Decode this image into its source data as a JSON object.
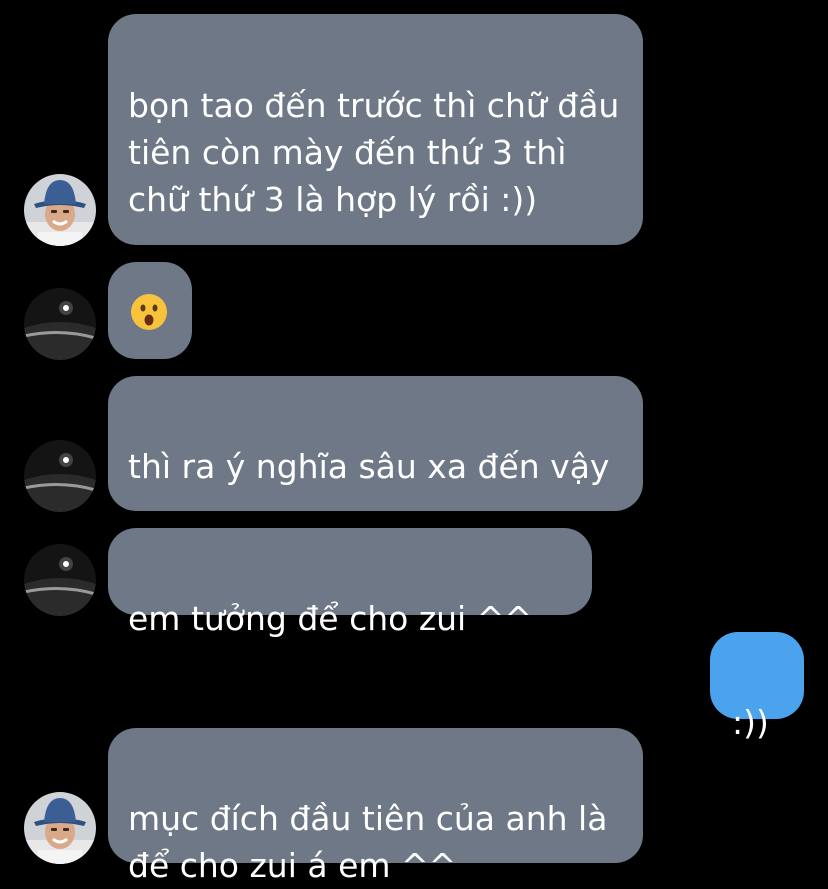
{
  "theme": {
    "background": "#000000",
    "incoming_bubble": "#6e7886",
    "outgoing_bubble": "#4ba3ee",
    "text": "#ffffff"
  },
  "messages": [
    {
      "direction": "incoming",
      "sender_avatar": "bucket-hat-person-avatar",
      "text": "bọn tao đến trước thì chữ đầu tiên còn mày đến thứ 3 thì chữ thứ 3 là hợp lý rồi :))"
    },
    {
      "direction": "incoming",
      "sender_avatar": "dark-surface-light-avatar",
      "emoji": "face-with-open-mouth-icon"
    },
    {
      "direction": "incoming",
      "sender_avatar": "dark-surface-light-avatar",
      "text": "thì ra ý nghĩa sâu xa đến vậy"
    },
    {
      "direction": "incoming",
      "sender_avatar": "dark-surface-light-avatar",
      "text": "em tưởng để cho zui ^^"
    },
    {
      "direction": "outgoing",
      "text": ":))"
    },
    {
      "direction": "incoming",
      "sender_avatar": "bucket-hat-person-avatar",
      "text": "mục đích đầu tiên của anh là để cho zui á em ^^"
    }
  ]
}
